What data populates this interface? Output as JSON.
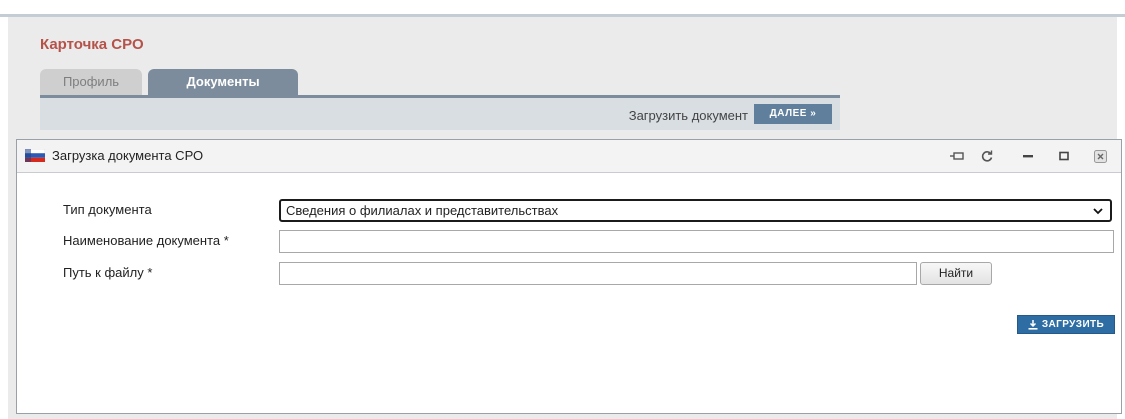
{
  "page": {
    "card_title": "Карточка СРО",
    "tabs": [
      {
        "label": "Профиль",
        "active": false
      },
      {
        "label": "Документы",
        "active": true
      }
    ],
    "toolbar": {
      "upload_doc_label": "Загрузить документ",
      "next_label": "ДАЛЕЕ"
    }
  },
  "dialog": {
    "title": "Загрузка документа СРО",
    "controls": [
      "pin-icon",
      "refresh-icon",
      "minimize-icon",
      "maximize-icon",
      "close-icon"
    ],
    "form": {
      "doc_type_label": "Тип документа",
      "doc_type_value": "Сведения о филиалах и представительствах",
      "doc_name_label": "Наименование документа *",
      "doc_name_value": "",
      "file_path_label": "Путь к файлу *",
      "file_path_value": "",
      "find_label": "Найти",
      "upload_label": "ЗАГРУЗИТЬ"
    }
  },
  "colors": {
    "title_red": "#b5534a",
    "tab_active": "#7c8c9c",
    "next_button": "#5f7f9d",
    "upload_button": "#2d6da3"
  }
}
